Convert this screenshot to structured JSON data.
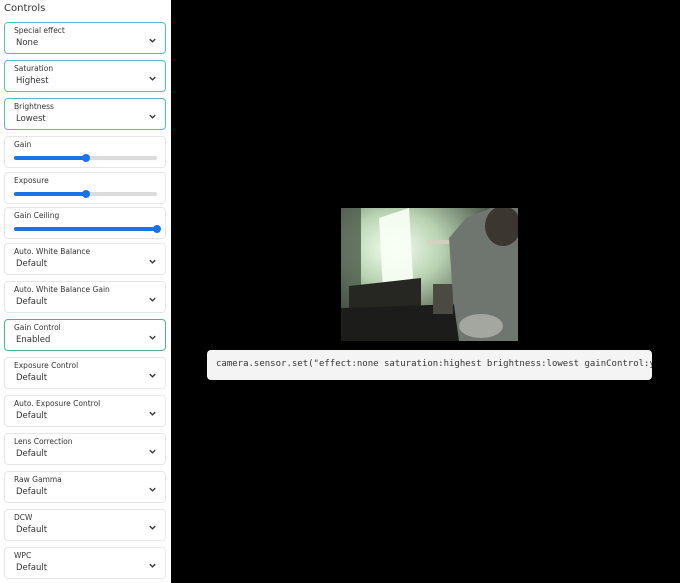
{
  "sidebar": {
    "title": "Controls",
    "controls": [
      {
        "label": "Special effect",
        "value": "None"
      },
      {
        "label": "Saturation",
        "value": "Highest"
      },
      {
        "label": "Brightness",
        "value": "Lowest"
      },
      {
        "label": "Gain",
        "level": 0.5
      },
      {
        "label": "Exposure",
        "level": 0.5
      },
      {
        "label": "Gain Ceiling",
        "level": 1.0
      },
      {
        "label": "Auto. White Balance",
        "value": "Default"
      },
      {
        "label": "Auto. White Balance Gain",
        "value": "Default"
      },
      {
        "label": "Gain Control",
        "value": "Enabled"
      },
      {
        "label": "Exposure Control",
        "value": "Default"
      },
      {
        "label": "Auto. Exposure Control",
        "value": "Default"
      },
      {
        "label": "Lens Correction",
        "value": "Default"
      },
      {
        "label": "Raw Gamma",
        "value": "Default"
      },
      {
        "label": "DCW",
        "value": "Default"
      },
      {
        "label": "WPC",
        "value": "Default"
      }
    ]
  },
  "command": {
    "text": "camera.sensor.set(\"effect:none saturation:highest brightness:lowest gainControl:yes"
  },
  "colors": {
    "accent": "#1a73e8",
    "selected_border": "#4fbdc7",
    "enabled_border": "#4fb38a"
  }
}
